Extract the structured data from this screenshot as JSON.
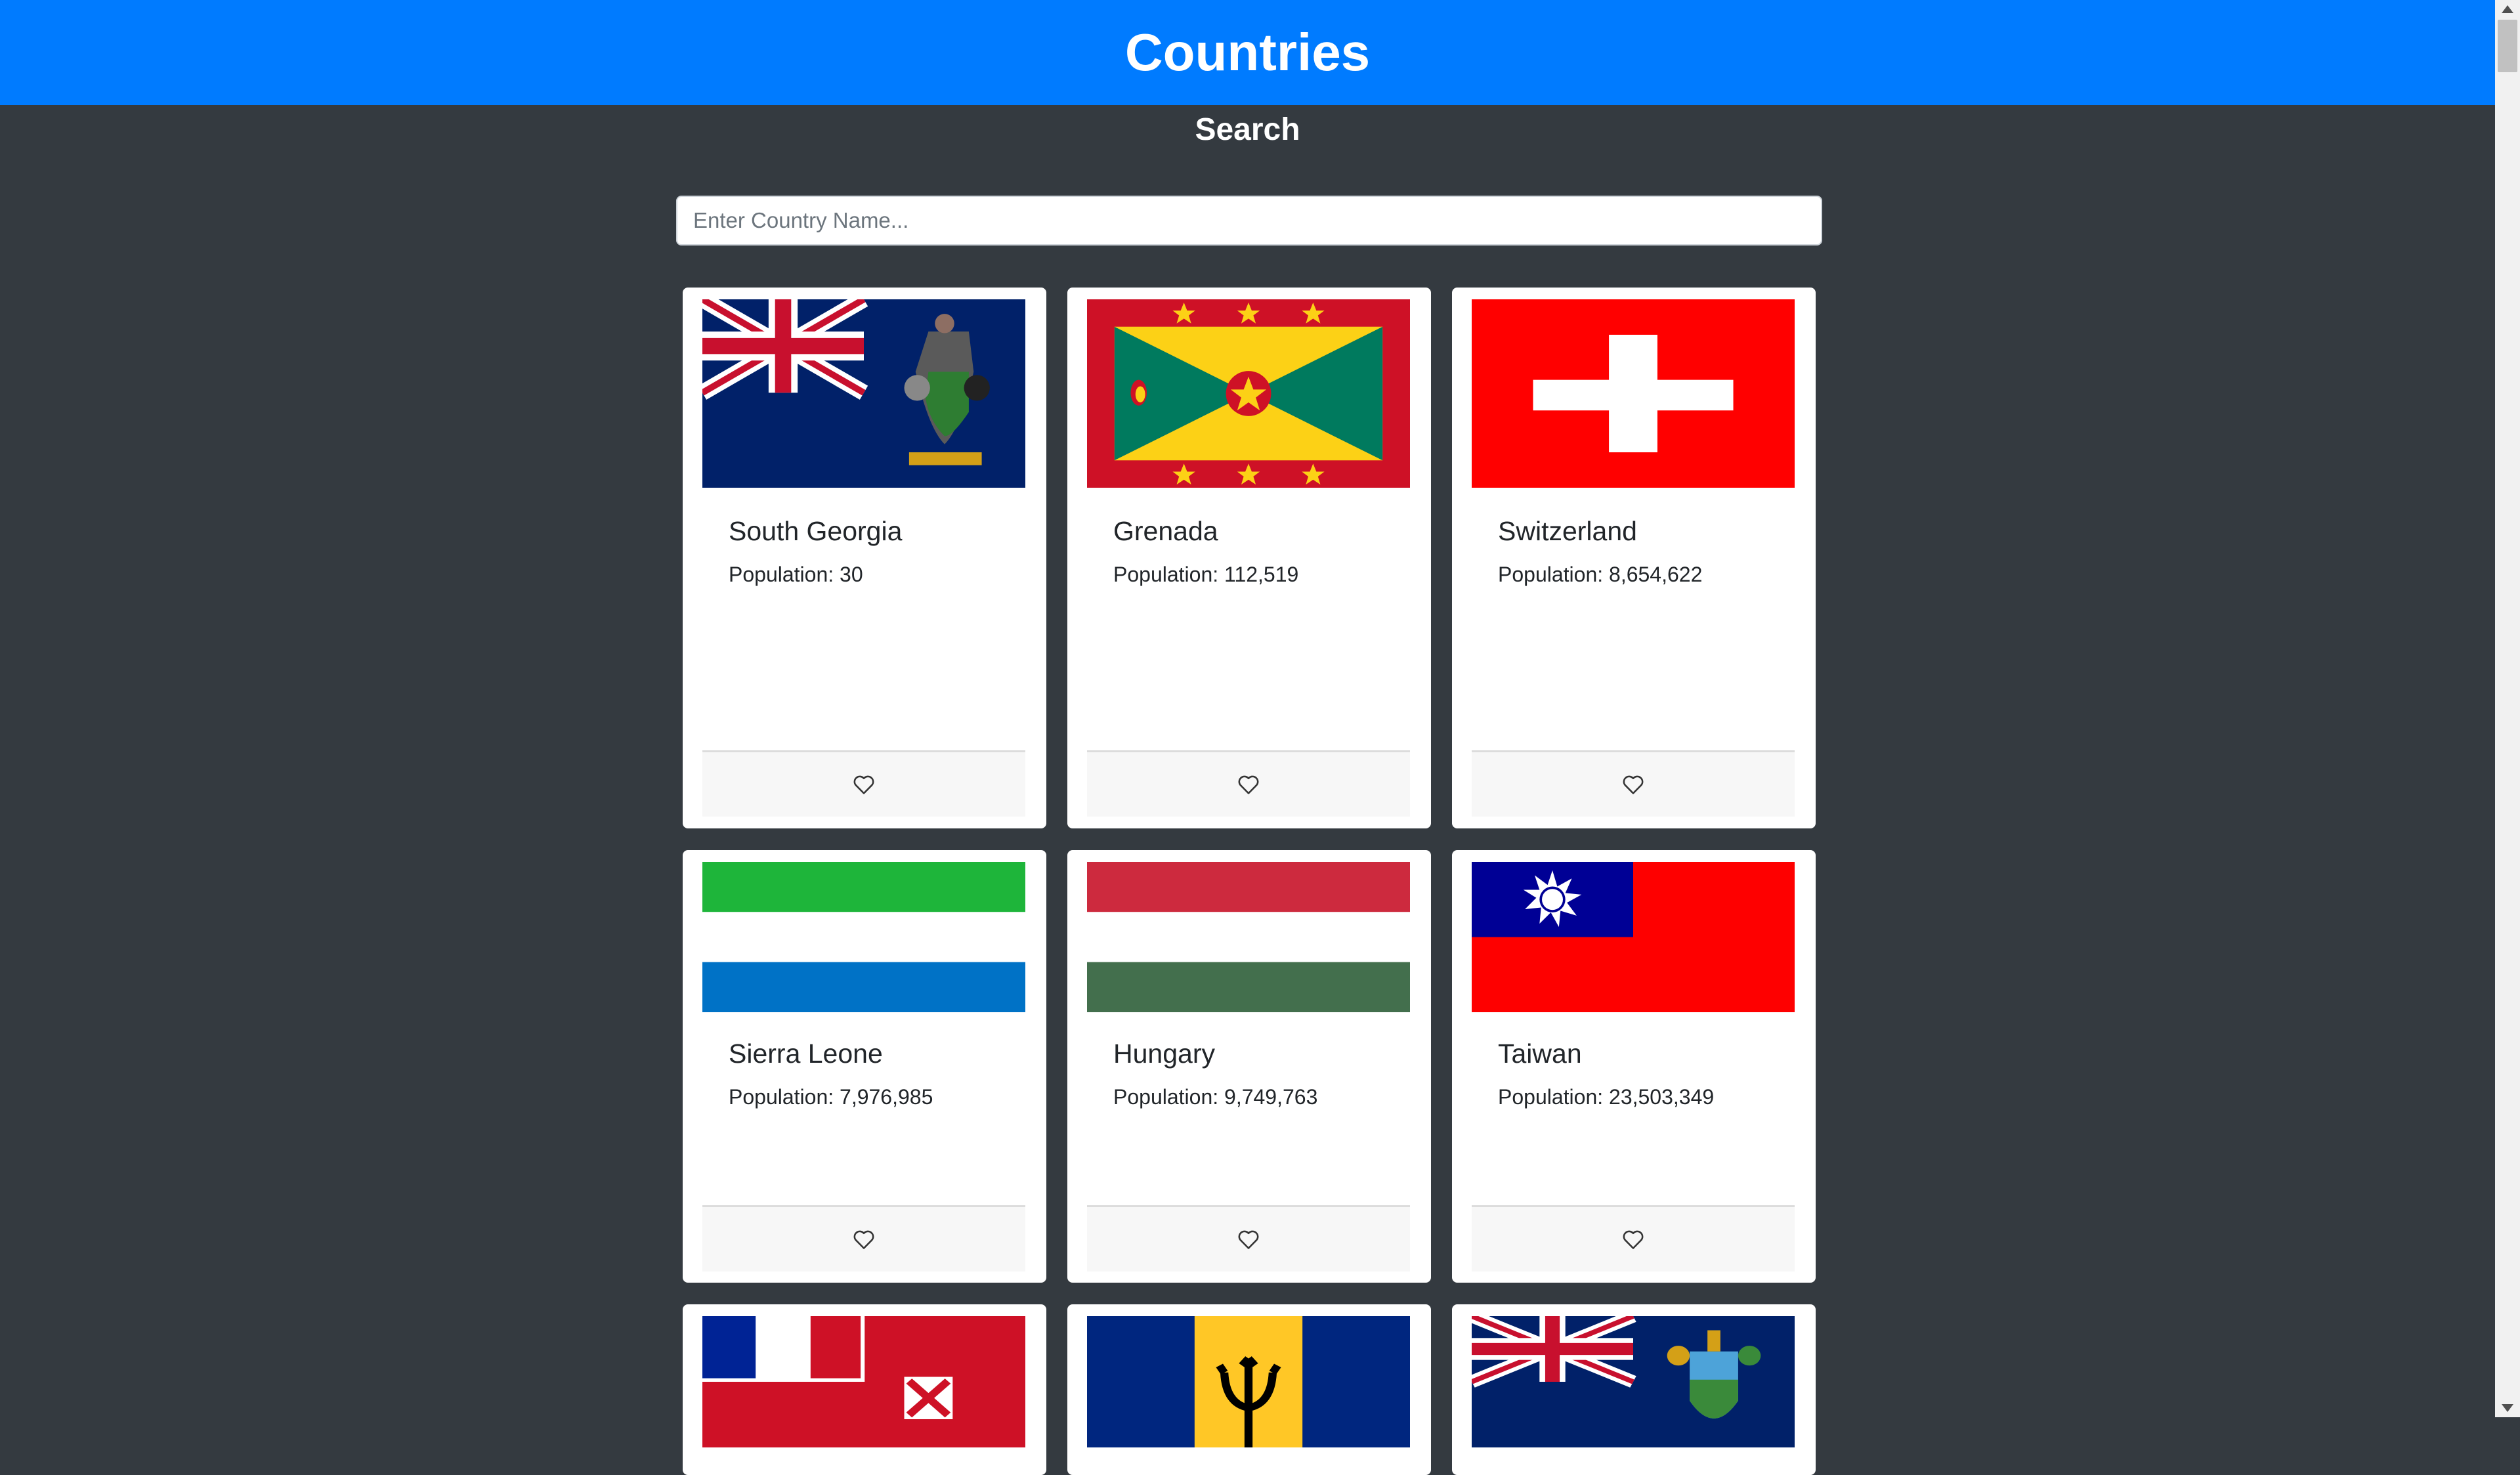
{
  "header": {
    "title": "Countries"
  },
  "search": {
    "heading": "Search",
    "placeholder": "Enter Country Name...",
    "value": ""
  },
  "countries": [
    {
      "name": "South Georgia",
      "population_label": "Population: 30",
      "flag": "south-georgia-flag"
    },
    {
      "name": "Grenada",
      "population_label": "Population: 112,519",
      "flag": "grenada-flag"
    },
    {
      "name": "Switzerland",
      "population_label": "Population: 8,654,622",
      "flag": "switzerland-flag"
    },
    {
      "name": "Sierra Leone",
      "population_label": "Population: 7,976,985",
      "flag": "sierra-leone-flag"
    },
    {
      "name": "Hungary",
      "population_label": "Population: 9,749,763",
      "flag": "hungary-flag"
    },
    {
      "name": "Taiwan",
      "population_label": "Population: 23,503,349",
      "flag": "taiwan-flag"
    },
    {
      "name": "",
      "population_label": "",
      "flag": "wallis-and-futuna-flag"
    },
    {
      "name": "",
      "population_label": "",
      "flag": "barbados-flag"
    },
    {
      "name": "",
      "population_label": "",
      "flag": "pitcairn-islands-flag"
    }
  ],
  "favorite_icon": "heart-outline-icon",
  "colors": {
    "navbar": "#007bff",
    "page_background": "#343a40",
    "card_background": "#ffffff",
    "card_footer": "#f7f7f7"
  }
}
